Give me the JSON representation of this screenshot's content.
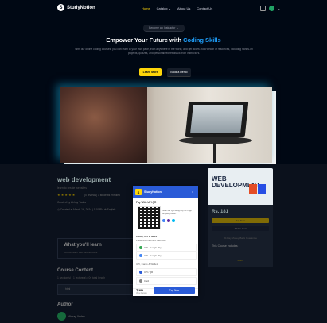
{
  "nav": {
    "brand": "StudyNotion",
    "links": [
      "Home",
      "Catalog",
      "About Us",
      "Contact Us"
    ],
    "catalog_chevron": "⌄",
    "avatar_chevron": "⌄"
  },
  "hero": {
    "pill": "Become an Instructor  →",
    "title_plain": "Empower Your Future with ",
    "title_highlight": "Coding Skills",
    "subtitle": "With our online coding courses, you can learn at your own pace, from anywhere in the world, and get access to a wealth of resources, including hands-on projects, quizzes, and personalized feedback from instructors.",
    "learn_more": "Learn More",
    "book_demo": "Book a Demo"
  },
  "course": {
    "title": "web development",
    "description": "learn to create websites",
    "rating_stars": "★ ★ ★ ★ ★",
    "reviews": "(0 reviews)  1 students enrolled",
    "created_by": "Created by Abhay Yadav",
    "meta": "◷ Created at March 16, 2024 | 1:10 PM    ⊕ English",
    "thumb_text": "WEB DEVELOPMENT",
    "price": "Rs. 181",
    "buy_now": "Buy Now",
    "add_to_cart": "Add to Cart",
    "guarantee": "30-Day Money-Back Guarantee",
    "includes": "This Course includes :",
    "share": "Share",
    "learn_heading": "What you'll learn",
    "learn_text": "you can learn web development",
    "content_heading": "Course Content",
    "content_meta": "1 section(s)  •  1 lecture(s)  •  0s total length",
    "section_name": "›  html",
    "author_heading": "Author",
    "author_name": "Abhay Yadav"
  },
  "razorpay": {
    "brand": "StudyNotion",
    "close": "×",
    "upi_label": "Pay With UPI QR",
    "qr_text": "Scan the QR using any UPI app on your phone.",
    "cards_label": "Cards, UPI & More",
    "preferred_label": "Preferred Payment Methods",
    "methods": [
      {
        "name": "UPI - Google Pay",
        "color": "#34a853"
      },
      {
        "name": "UPI - Google Pay",
        "color": "#4285f4"
      }
    ],
    "upi_label2": "UPI, Cards & Wallets",
    "options": [
      {
        "name": "UPI / QR",
        "color": "#2a5bd7"
      },
      {
        "name": "Card",
        "color": "#888888"
      }
    ],
    "amount": "₹ 181",
    "view_details": "View Details",
    "pay_now": "Pay Now"
  }
}
